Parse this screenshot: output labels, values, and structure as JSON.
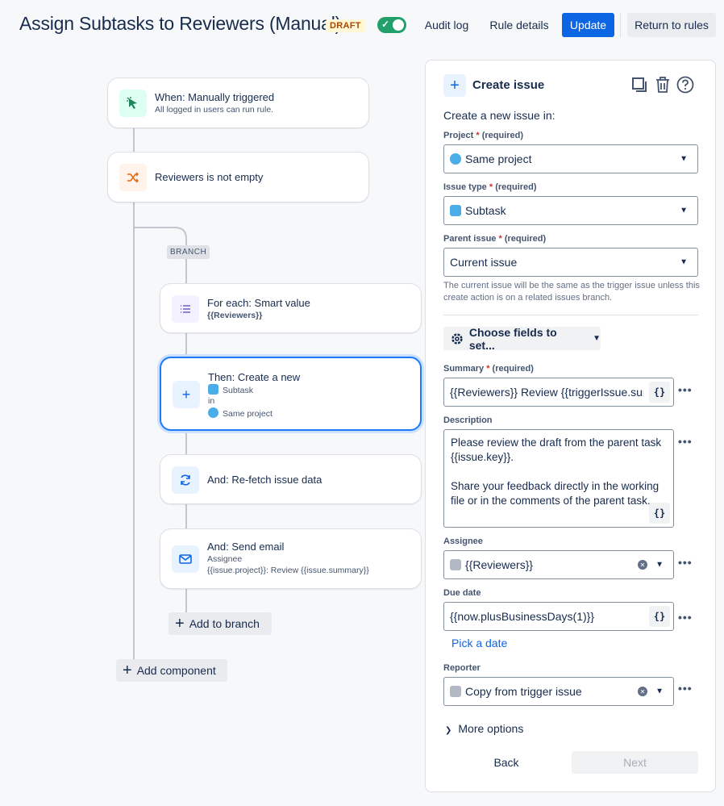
{
  "header": {
    "title": "Assign Subtasks to Reviewers (Manual)",
    "draft_label": "DRAFT",
    "audit_log": "Audit log",
    "rule_details": "Rule details",
    "update": "Update",
    "return_to_rules": "Return to rules"
  },
  "flow": {
    "trigger": {
      "title": "When: Manually triggered",
      "subtitle": "All logged in users can run rule."
    },
    "condition": {
      "title": "Reviewers is not empty"
    },
    "branch_label": "BRANCH",
    "for_each": {
      "title": "For each: Smart value",
      "subtitle": "{{Reviewers}}"
    },
    "create": {
      "title": "Then: Create a new",
      "type": "Subtask",
      "in": "in",
      "project": "Same project"
    },
    "refetch": {
      "title": "And: Re-fetch issue data"
    },
    "email": {
      "title": "And: Send email",
      "line1": "Assignee",
      "line2": "{{issue.project}}: Review {{issue.summary}}"
    },
    "add_to_branch": "Add to branch",
    "add_component": "Add component"
  },
  "panel": {
    "title": "Create issue",
    "subtitle": "Create a new issue in:",
    "project": {
      "label": "Project",
      "req_star": "*",
      "req_text": "(required)",
      "value": "Same project"
    },
    "issue_type": {
      "label": "Issue type",
      "req_star": "*",
      "req_text": "(required)",
      "value": "Subtask"
    },
    "parent_issue": {
      "label": "Parent issue",
      "req_star": "*",
      "req_text": "(required)",
      "value": "Current issue"
    },
    "helper": "The current issue will be the same as the trigger issue unless this create action is on a related issues branch.",
    "choose_fields": "Choose fields to set...",
    "summary": {
      "label": "Summary",
      "req_star": "*",
      "req_text": "(required)",
      "value": "{{Reviewers}} Review {{triggerIssue.summ"
    },
    "description": {
      "label": "Description",
      "value": "Please review the draft from the parent task {{issue.key}}.\n\nShare your feedback directly in the working file or in the comments of the parent task."
    },
    "assignee": {
      "label": "Assignee",
      "value": "{{Reviewers}}"
    },
    "due_date": {
      "label": "Due date",
      "value": "{{now.plusBusinessDays(1)}}",
      "pick": "Pick a date"
    },
    "reporter": {
      "label": "Reporter",
      "value": "Copy from trigger issue"
    },
    "brace_label": "{}",
    "dots_label": "•••",
    "more_options": "More options",
    "back": "Back",
    "next": "Next"
  },
  "colors": {
    "primary": "#0c66e4",
    "toggle_on": "#22a06b",
    "selected_border": "#1d7afc"
  }
}
